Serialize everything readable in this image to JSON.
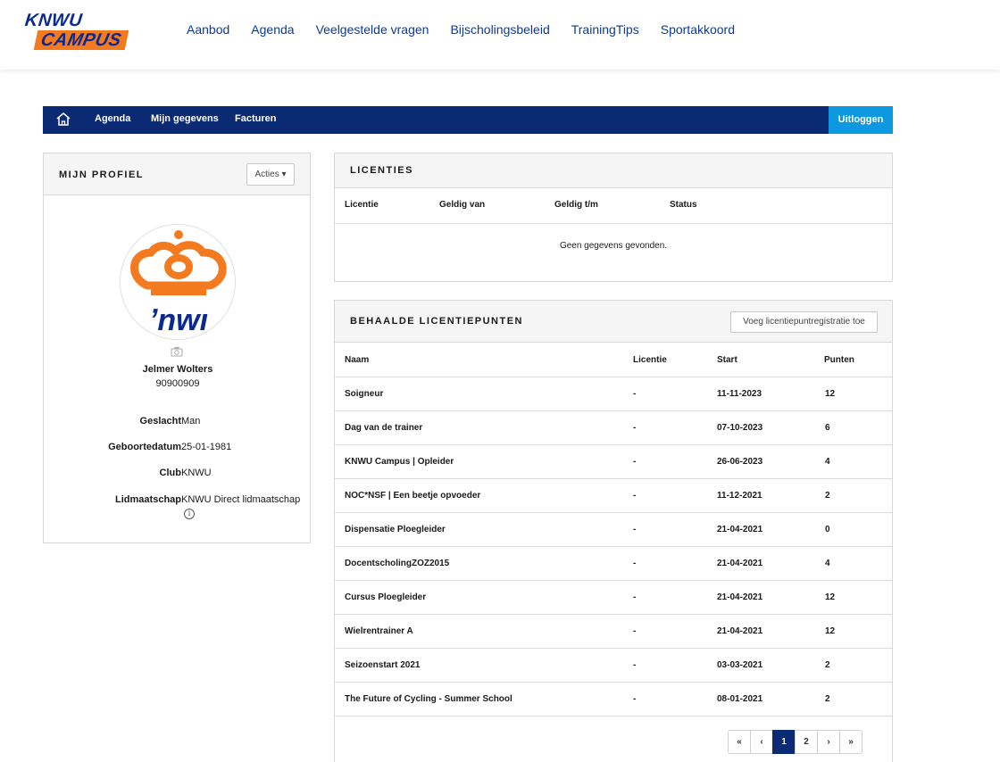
{
  "brand": {
    "line1": "KNWU",
    "line2": "CAMPUS",
    "orange": "#f47a20",
    "blue": "#0a2a73"
  },
  "main_nav": [
    "Aanbod",
    "Agenda",
    "Veelgestelde vragen",
    "Bijscholingsbeleid",
    "TrainingTips",
    "Sportakkoord"
  ],
  "sub_nav": {
    "home_icon": "home-icon",
    "items": [
      "Agenda",
      "Mijn gegevens",
      "Facturen"
    ],
    "logout": "Uitloggen"
  },
  "profile": {
    "title": "MIJN PROFIEL",
    "actions": "Acties ▾",
    "avatar_text": "ʼnwı",
    "name": "Jelmer Wolters",
    "number": "90900909",
    "fields": [
      {
        "label": "Geslacht",
        "value": "Man"
      },
      {
        "label": "Geboortedatum",
        "value": "25-01-1981"
      },
      {
        "label": "Club",
        "value": "KNWU"
      },
      {
        "label": "Lidmaatschap",
        "value": "KNWU Direct lidmaatschap"
      }
    ],
    "info_glyph": "i"
  },
  "licenties": {
    "title": "LICENTIES",
    "columns": [
      "Licentie",
      "Geldig van",
      "Geldig t/m",
      "Status"
    ],
    "empty": "Geen gegevens gevonden."
  },
  "licentiepunten": {
    "title": "BEHAALDE LICENTIEPUNTEN",
    "add_button": "Voeg licentiepuntregistratie toe",
    "columns": [
      "Naam",
      "Licentie",
      "Start",
      "Punten"
    ],
    "rows": [
      {
        "naam": "Soigneur",
        "licentie": "-",
        "start": "11-11-2023",
        "punten": "12"
      },
      {
        "naam": "Dag van de trainer",
        "licentie": "-",
        "start": "07-10-2023",
        "punten": "6"
      },
      {
        "naam": "KNWU Campus | Opleider",
        "licentie": "-",
        "start": "26-06-2023",
        "punten": "4"
      },
      {
        "naam": "NOC*NSF | Een beetje opvoeder",
        "licentie": "-",
        "start": "11-12-2021",
        "punten": "2"
      },
      {
        "naam": "Dispensatie Ploegleider",
        "licentie": "-",
        "start": "21-04-2021",
        "punten": "0"
      },
      {
        "naam": "DocentscholingZOZ2015",
        "licentie": "-",
        "start": "21-04-2021",
        "punten": "4"
      },
      {
        "naam": "Cursus Ploegleider",
        "licentie": "-",
        "start": "21-04-2021",
        "punten": "12"
      },
      {
        "naam": "Wielrentrainer A",
        "licentie": "-",
        "start": "21-04-2021",
        "punten": "12"
      },
      {
        "naam": "Seizoenstart 2021",
        "licentie": "-",
        "start": "03-03-2021",
        "punten": "2"
      },
      {
        "naam": "The Future of Cycling - Summer School",
        "licentie": "-",
        "start": "08-01-2021",
        "punten": "2"
      }
    ],
    "pager": [
      "«",
      "‹",
      "1",
      "2",
      "›",
      "»"
    ],
    "current_page": "1"
  }
}
